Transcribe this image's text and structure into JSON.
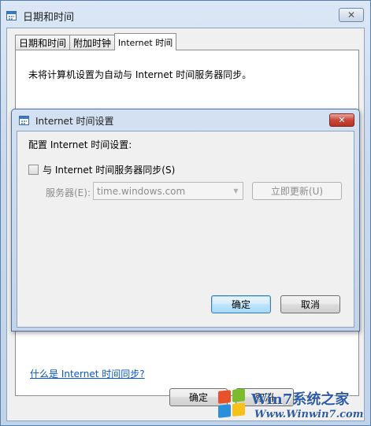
{
  "outer_dialog": {
    "title": "日期和时间",
    "close_label": "✕",
    "tabs": [
      {
        "label": "日期和时间",
        "active": false
      },
      {
        "label": "附加时钟",
        "active": false
      },
      {
        "label": "Internet 时间",
        "active": true
      }
    ],
    "panel_text": "未将计算机设置为自动与 Internet 时间服务器同步。",
    "help_link": "什么是 Internet 时间同步?",
    "ok_label": "确定",
    "cancel_label": "取消"
  },
  "inner_dialog": {
    "title": "Internet 时间设置",
    "close_label": "✕",
    "heading": "配置 Internet 时间设置:",
    "sync_checkbox_label": "与 Internet 时间服务器同步(S)",
    "sync_checked": false,
    "server_label": "服务器(E):",
    "server_value": "time.windows.com",
    "update_now_label": "立即更新(U)",
    "ok_label": "确定",
    "cancel_label": "取消"
  },
  "watermark": {
    "brand": "Win7系统之家",
    "url": "Www.Winwin7.com"
  },
  "icons": {
    "window_icon": "calendar-clock-icon",
    "dropdown": "chevron-down-icon",
    "logo": "windows-flag-icon"
  }
}
